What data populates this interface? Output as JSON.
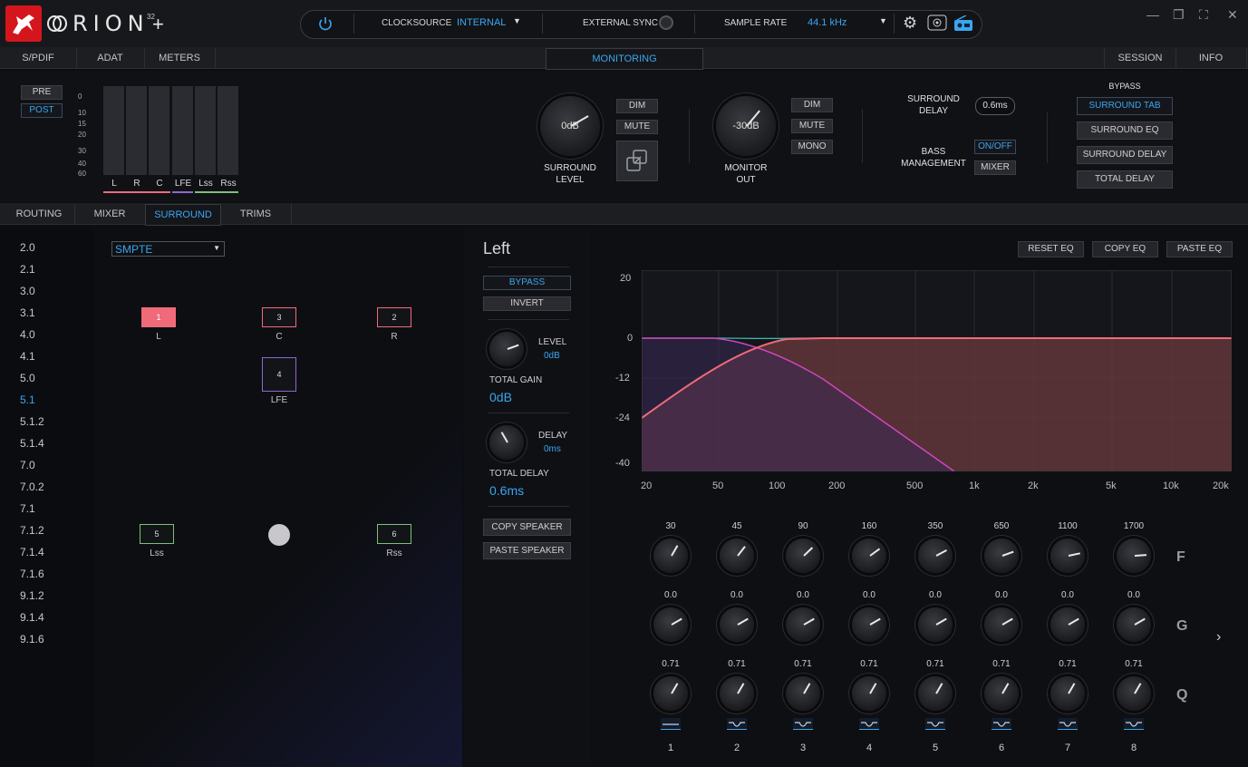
{
  "app": {
    "brand": "RION",
    "brand_sup": "32"
  },
  "topbar": {
    "clock_source_label": "CLOCKSOURCE",
    "clock_source_value": "INTERNAL",
    "external_sync_label": "EXTERNAL SYNC",
    "sample_rate_label": "SAMPLE RATE",
    "sample_rate_value": "44.1 kHz"
  },
  "tabs1": [
    "S/PDIF",
    "ADAT",
    "METERS",
    "MONITORING",
    "SESSION",
    "INFO"
  ],
  "monitoring": {
    "pre": "PRE",
    "post": "POST",
    "scale": [
      "0",
      "10",
      "15",
      "20",
      "30",
      "40",
      "60"
    ],
    "channels": [
      "L",
      "R",
      "C",
      "LFE",
      "Lss",
      "Rss"
    ],
    "surround_level_value": "0dB",
    "surround_level_label": [
      "SURROUND",
      "LEVEL"
    ],
    "dim": "DIM",
    "mute": "MUTE",
    "mono": "MONO",
    "monitor_out_value": "-30dB",
    "monitor_out_label": [
      "MONITOR",
      "OUT"
    ],
    "surround_delay_label": [
      "SURROUND",
      "DELAY"
    ],
    "surround_delay_value": "0.6ms",
    "bass_mgmt_label": [
      "BASS",
      "MANAGEMENT"
    ],
    "on_off": "ON/OFF",
    "mixer": "MIXER",
    "bypass_title": "BYPASS",
    "bypass_buttons": [
      "SURROUND TAB",
      "SURROUND EQ",
      "SURROUND DELAY",
      "TOTAL DELAY"
    ]
  },
  "tabs2": [
    "ROUTING",
    "MIXER",
    "SURROUND",
    "TRIMS"
  ],
  "formats": [
    "2.0",
    "2.1",
    "3.0",
    "3.1",
    "4.0",
    "4.1",
    "5.0",
    "5.1",
    "5.1.2",
    "5.1.4",
    "7.0",
    "7.0.2",
    "7.1",
    "7.1.2",
    "7.1.4",
    "7.1.6",
    "9.1.2",
    "9.1.4",
    "9.1.6"
  ],
  "selected_format": "5.1",
  "layout_select": "SMPTE",
  "speakers": [
    {
      "num": "1",
      "label": "L"
    },
    {
      "num": "3",
      "label": "C"
    },
    {
      "num": "2",
      "label": "R"
    },
    {
      "num": "4",
      "label": "LFE"
    },
    {
      "num": "5",
      "label": "Lss"
    },
    {
      "num": "6",
      "label": "Rss"
    }
  ],
  "channel": {
    "title": "Left",
    "bypass": "BYPASS",
    "invert": "INVERT",
    "level_label": "LEVEL",
    "level_value": "0dB",
    "total_gain_label": "TOTAL GAIN",
    "total_gain_value": "0dB",
    "delay_label": "DELAY",
    "delay_value": "0ms",
    "total_delay_label": "TOTAL DELAY",
    "total_delay_value": "0.6ms",
    "copy_speaker": "COPY SPEAKER",
    "paste_speaker": "PASTE SPEAKER"
  },
  "eq": {
    "reset": "RESET EQ",
    "copy": "COPY EQ",
    "paste": "PASTE EQ",
    "y_ticks": [
      "20",
      "0",
      "-12",
      "-24",
      "-40"
    ],
    "x_ticks": [
      "20",
      "50",
      "100",
      "200",
      "500",
      "1k",
      "2k",
      "5k",
      "10k",
      "20k"
    ]
  },
  "bands": {
    "freq": [
      "30",
      "45",
      "90",
      "160",
      "350",
      "650",
      "1100",
      "1700"
    ],
    "gain": [
      "0.0",
      "0.0",
      "0.0",
      "0.0",
      "0.0",
      "0.0",
      "0.0",
      "0.0"
    ],
    "q": [
      "0.71",
      "0.71",
      "0.71",
      "0.71",
      "0.71",
      "0.71",
      "0.71",
      "0.71"
    ],
    "numbers": [
      "1",
      "2",
      "3",
      "4",
      "5",
      "6",
      "7",
      "8"
    ],
    "row_labels": [
      "F",
      "G",
      "Q"
    ]
  },
  "colors": {
    "accent": "#3aa6f0",
    "brand_red": "#d4161c",
    "speaker_active": "#f06a7a",
    "lfe": "#8a6ad0",
    "surround": "#7ac07a"
  }
}
